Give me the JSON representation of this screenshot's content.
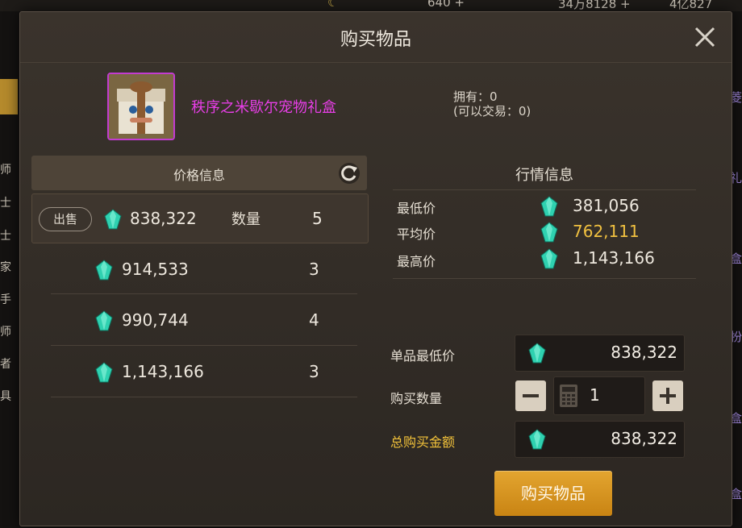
{
  "background": {
    "currency_1": "640 +",
    "currency_2": "34万8128 +",
    "currency_3": "4亿827",
    "side_labels": [
      "师",
      "士",
      "士",
      "家",
      "手",
      "师",
      "者",
      "具"
    ],
    "right_labels": [
      "菱",
      "礼",
      "盒",
      "扮",
      "盒",
      "盒"
    ]
  },
  "dialog": {
    "title": "购买物品",
    "item": {
      "name": "秩序之米歇尔宠物礼盒",
      "owned": "拥有：0",
      "tradable": "(可以交易：0)"
    },
    "price_info": {
      "header": "价格信息",
      "sell_label": "出售",
      "qty_label": "数量",
      "rows": [
        {
          "price": "838,322",
          "qty": "5"
        },
        {
          "price": "914,533",
          "qty": "3"
        },
        {
          "price": "990,744",
          "qty": "4"
        },
        {
          "price": "1,143,166",
          "qty": "3"
        }
      ]
    },
    "market": {
      "title": "行情信息",
      "lowest_label": "最低价",
      "lowest_value": "381,056",
      "average_label": "平均价",
      "average_value": "762,111",
      "highest_label": "最高价",
      "highest_value": "1,143,166"
    },
    "form": {
      "unit_price_label": "单品最低价",
      "unit_price_value": "838,322",
      "qty_label": "购买数量",
      "qty_value": "1",
      "minus": "−",
      "plus": "+",
      "total_label": "总购买金额",
      "total_value": "838,322"
    },
    "buy_button": "购买物品"
  },
  "colors": {
    "accent_gold": "#f2c23a",
    "item_name_purple": "#e73ee6",
    "buy_button": "#d9951f",
    "gem_teal": "#2fd1b0"
  }
}
